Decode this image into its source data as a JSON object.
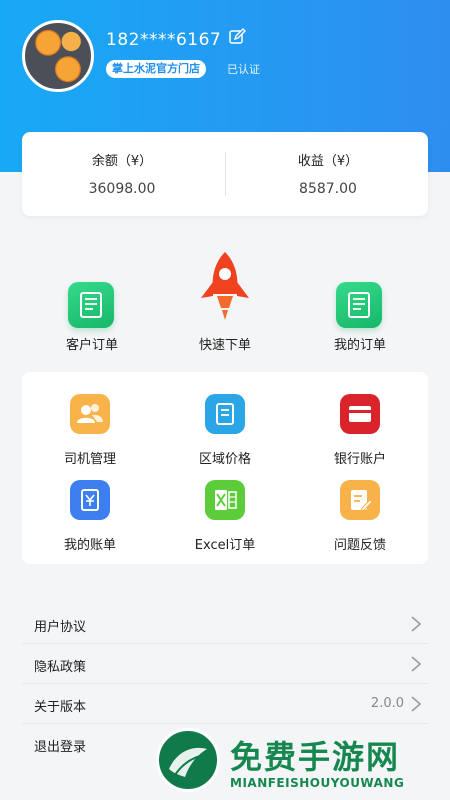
{
  "profile": {
    "phone": "182****6167",
    "shop_name": "掌上水泥官方门店",
    "verified_label": "已认证"
  },
  "balance": {
    "balance_label": "余额（¥）",
    "balance_value": "36098.00",
    "income_label": "收益（¥）",
    "income_value": "8587.00"
  },
  "quick_actions": [
    {
      "label": "客户订单",
      "icon": "document-icon"
    },
    {
      "label": "快速下单",
      "icon": "rocket-icon"
    },
    {
      "label": "我的订单",
      "icon": "document-icon"
    }
  ],
  "grid": [
    {
      "label": "司机管理",
      "icon": "users-icon",
      "color": "#f8b44a"
    },
    {
      "label": "区域价格",
      "icon": "book-icon",
      "color": "#2aa6e6"
    },
    {
      "label": "银行账户",
      "icon": "card-icon",
      "color": "#d9242c"
    },
    {
      "label": "我的账单",
      "icon": "bill-icon",
      "color": "#3d7ff0"
    },
    {
      "label": "Excel订单",
      "icon": "excel-icon",
      "color": "#5ccc3a"
    },
    {
      "label": "问题反馈",
      "icon": "feedback-icon",
      "color": "#f7b24a"
    }
  ],
  "menu": [
    {
      "label": "用户协议",
      "value": ""
    },
    {
      "label": "隐私政策",
      "value": ""
    },
    {
      "label": "关于版本",
      "value": "2.0.0"
    },
    {
      "label": "退出登录",
      "value": ""
    }
  ],
  "watermark": {
    "title": "免费手游网",
    "subtitle": "MIANFEISHOUYOUWANG"
  },
  "colors": {
    "header_start": "#18a9f5",
    "header_end": "#2e8ef0",
    "brand_green": "#15874f"
  }
}
